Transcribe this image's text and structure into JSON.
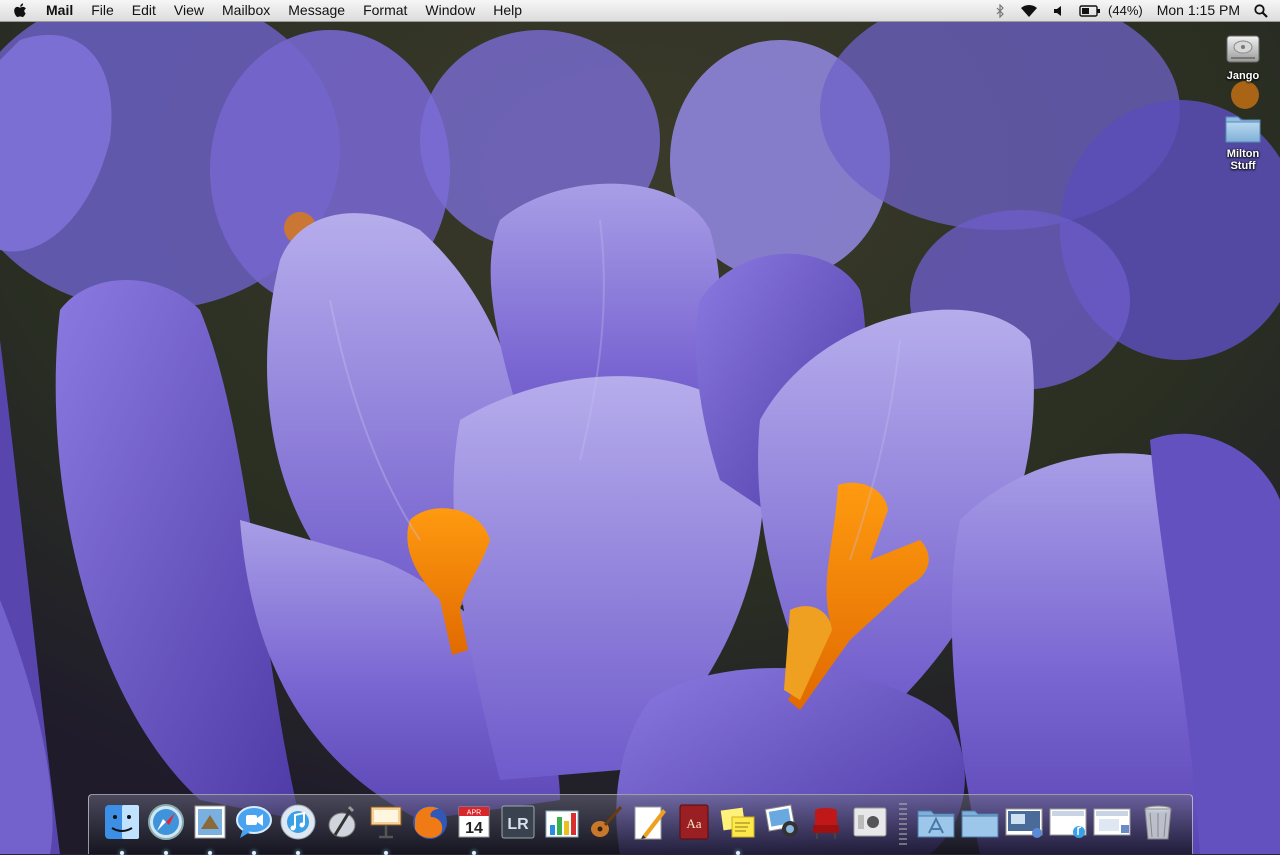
{
  "menubar": {
    "app_name": "Mail",
    "menus": [
      "File",
      "Edit",
      "View",
      "Mailbox",
      "Message",
      "Format",
      "Window",
      "Help"
    ],
    "battery_percent": "(44%)",
    "clock": "Mon 1:15 PM",
    "status_icons": [
      "bluetooth-icon",
      "wifi-icon",
      "volume-icon",
      "battery-icon",
      "spotlight-icon"
    ]
  },
  "desktop": {
    "icons": [
      {
        "label": "Jango",
        "icon": "hard-drive-icon"
      },
      {
        "label": "Milton\nStuff",
        "icon": "folder-icon"
      }
    ]
  },
  "dock": {
    "apps": [
      {
        "icon": "finder-icon",
        "running": true
      },
      {
        "icon": "safari-icon",
        "running": true
      },
      {
        "icon": "mail-icon",
        "running": true
      },
      {
        "icon": "ichat-icon",
        "running": true
      },
      {
        "icon": "itunes-icon",
        "running": true
      },
      {
        "icon": "script-editor-icon",
        "running": false
      },
      {
        "icon": "keynote-icon",
        "running": true
      },
      {
        "icon": "firefox-icon",
        "running": false
      },
      {
        "icon": "ical-icon",
        "running": true,
        "month": "APR",
        "day": "14"
      },
      {
        "icon": "lightroom-icon",
        "running": false,
        "text": "LR"
      },
      {
        "icon": "numbers-icon",
        "running": false
      },
      {
        "icon": "garageband-icon",
        "running": false
      },
      {
        "icon": "pages-icon",
        "running": false
      },
      {
        "icon": "dictionary-icon",
        "running": false,
        "text": "Aa"
      },
      {
        "icon": "stickies-icon",
        "running": true
      },
      {
        "icon": "iphoto-icon",
        "running": false
      },
      {
        "icon": "front-row-icon",
        "running": false
      },
      {
        "icon": "system-profiler-icon",
        "running": false
      }
    ],
    "stacks": [
      {
        "icon": "applications-folder-icon"
      },
      {
        "icon": "documents-folder-icon"
      },
      {
        "icon": "screenshot-stack-icon"
      },
      {
        "icon": "music-stack-icon"
      },
      {
        "icon": "downloads-stack-icon"
      },
      {
        "icon": "trash-icon"
      }
    ]
  }
}
